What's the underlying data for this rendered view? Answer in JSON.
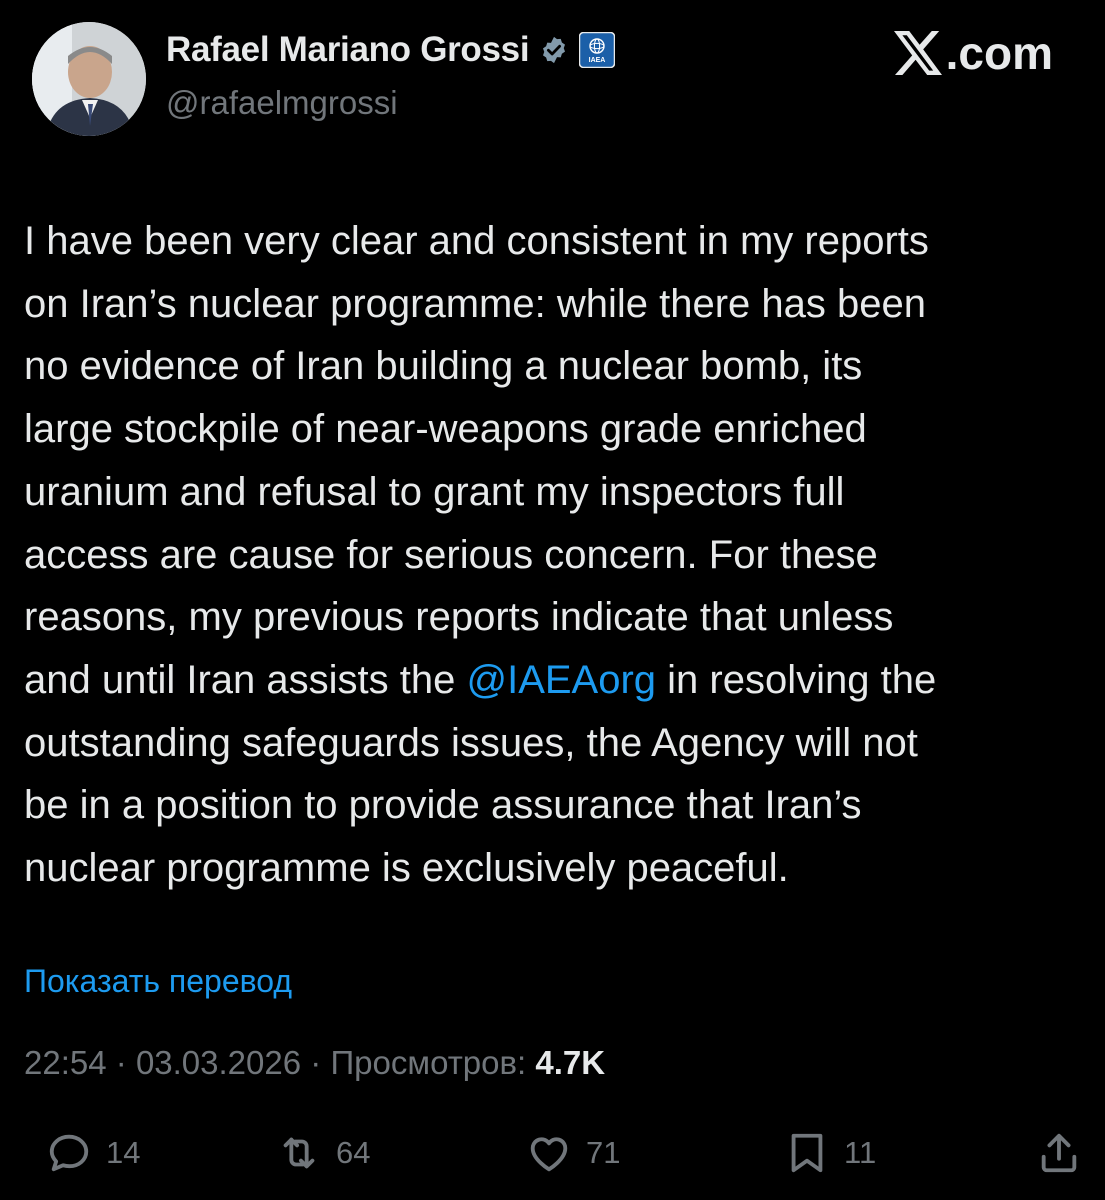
{
  "author": {
    "display_name": "Rafael Mariano Grossi",
    "handle": "@rafaelmgrossi",
    "org_badge_text": "IAEA"
  },
  "site": {
    "logo_text": ".com"
  },
  "tweet": {
    "text_before_mention": "I have been very clear and consistent in my reports\non Iran’s nuclear programme: while there has been\nno evidence of Iran building a nuclear bomb, its\nlarge stockpile of near-weapons grade enriched\nuranium and refusal to grant my inspectors full\naccess are cause for serious concern. For these\nreasons, my previous reports indicate that unless\nand until Iran assists the ",
    "mention": "@IAEAorg",
    "text_after_mention": " in resolving the\noutstanding safeguards issues, the Agency will not\nbe in a position to provide assurance that Iran’s\nnuclear programme is exclusively peaceful."
  },
  "translate_label": "Показать перевод",
  "meta": {
    "time": "22:54",
    "separator": "·",
    "date": "03.03.2026",
    "views_label": "Просмотров:",
    "views_count": "4.7K"
  },
  "actions": {
    "replies": "14",
    "reposts": "64",
    "likes": "71",
    "bookmarks": "11"
  },
  "colors": {
    "background": "#000000",
    "text": "#e7e9ea",
    "secondary": "#71767b",
    "accent": "#1d9bf0"
  },
  "icons": [
    "verified-icon",
    "iaea-badge-icon",
    "x-logo-icon",
    "reply-icon",
    "repost-icon",
    "like-icon",
    "bookmark-icon",
    "share-icon"
  ]
}
